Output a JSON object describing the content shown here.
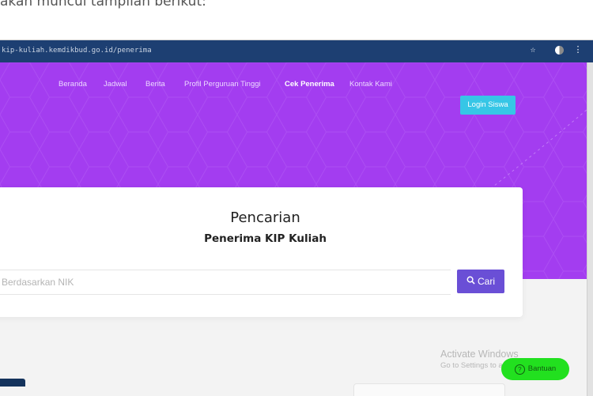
{
  "article": {
    "text": "akan muncul tampilan berikut:"
  },
  "browser": {
    "url": "kip-kuliah.kemdikbud.go.id/penerima",
    "icons": {
      "bookmark": "star-icon",
      "extension": "extension-icon",
      "menu": "kebab-menu-icon"
    }
  },
  "nav": {
    "items": [
      {
        "label": "Beranda"
      },
      {
        "label": "Jadwal"
      },
      {
        "label": "Berita"
      },
      {
        "label": "Profil Perguruan Tinggi"
      },
      {
        "label": "Cek Penerima"
      },
      {
        "label": "Kontak Kami"
      }
    ],
    "login_label": "Login Siswa"
  },
  "search": {
    "title": "Pencarian",
    "subtitle": "Penerima KIP Kuliah",
    "placeholder": "Berdasarkan NIK",
    "button_label": "Cari"
  },
  "os_watermark": {
    "line1": "Activate Windows",
    "line2": "Go to Settings to activate Windows."
  },
  "help": {
    "label": "Bantuan"
  },
  "colors": {
    "hero": "#a33df0",
    "login": "#36c6e6",
    "search_button": "#6a4fd6",
    "help_button": "#22e01f",
    "address_bar": "#1d3f72"
  }
}
